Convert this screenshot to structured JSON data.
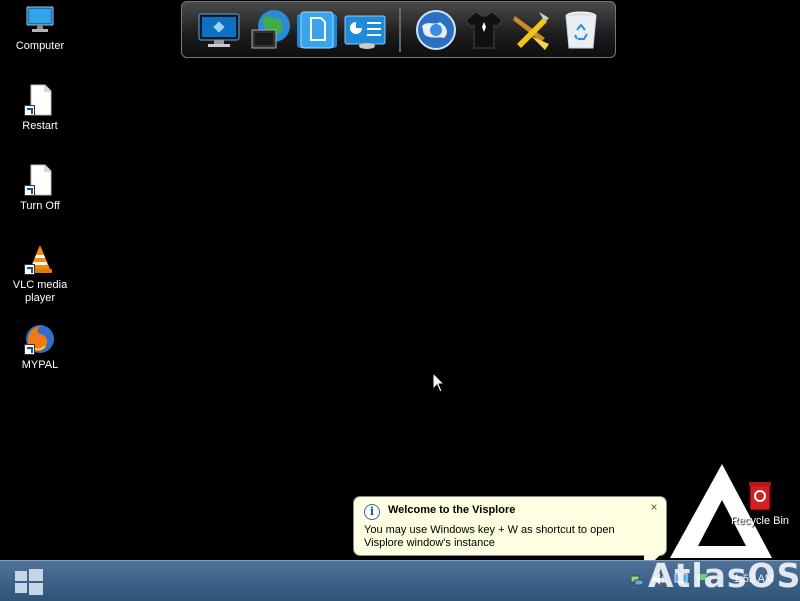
{
  "desktop": {
    "icons": [
      {
        "label": "Computer",
        "icon": "computer-icon"
      },
      {
        "label": "Restart",
        "icon": "document-icon"
      },
      {
        "label": "Turn Off",
        "icon": "document-icon"
      },
      {
        "label": "VLC media player",
        "icon": "vlc-icon"
      },
      {
        "label": "MYPAL",
        "icon": "firefox-icon"
      }
    ],
    "right_icons": [
      {
        "label": "Recycle Bin",
        "icon": "recycle-bin-icon"
      }
    ]
  },
  "dock": {
    "items": [
      {
        "icon": "monitor-icon"
      },
      {
        "icon": "network-globe-icon"
      },
      {
        "icon": "documents-folder-icon"
      },
      {
        "icon": "control-panel-icon"
      },
      {
        "icon": "globe-icon"
      },
      {
        "icon": "tshirt-icon"
      },
      {
        "icon": "tools-icon"
      },
      {
        "icon": "recycle-bin-icon"
      }
    ]
  },
  "balloon": {
    "title": "Welcome to the Visplore",
    "message": "You may use Windows key + W as shortcut to open Visplore window's instance",
    "close_glyph": "×"
  },
  "watermark": {
    "text": "AtlasOS"
  },
  "taskbar": {
    "clock": "1:52 AM"
  },
  "colors": {
    "taskbar_top": "#4f7398",
    "taskbar_bottom": "#2d5377",
    "balloon_bg": "#ffffe1"
  }
}
